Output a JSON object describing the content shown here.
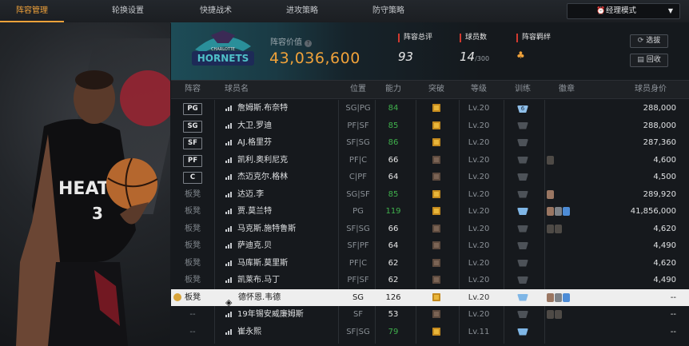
{
  "nav": {
    "tabs": [
      {
        "label": "阵容管理",
        "active": true
      },
      {
        "label": "轮换设置",
        "active": false
      },
      {
        "label": "快捷战术",
        "active": false
      },
      {
        "label": "进攻策略",
        "active": false
      },
      {
        "label": "防守策略",
        "active": false
      }
    ],
    "mode": "经理模式"
  },
  "team": {
    "value_label": "阵容价值",
    "value": "43,036,600",
    "rating_label": "阵容总评",
    "rating": "93",
    "count_label": "球员数",
    "count": "14",
    "count_max": "/300",
    "bond_label": "阵容羁绊",
    "buttons": {
      "select": "选拔",
      "recycle": "回收"
    },
    "logo_text": "CHARLOTTE HORNETS"
  },
  "columns": [
    "阵容",
    "球员名",
    "位置",
    "能力",
    "突破",
    "等级",
    "训练",
    "徽章",
    "球员身价"
  ],
  "rows": [
    {
      "slot": "PG",
      "name": "詹姆斯.布奈特",
      "pos": "SG|PG",
      "ability": "84",
      "ab_color": "g",
      "brk": "gold",
      "lv": "Lv.20",
      "train": "blue6",
      "train_num": "6",
      "badges": [],
      "price": "288,000"
    },
    {
      "slot": "SG",
      "name": "大卫.罗迪",
      "pos": "PF|SF",
      "ability": "85",
      "ab_color": "g",
      "brk": "gold",
      "lv": "Lv.20",
      "train": "gray",
      "badges": [],
      "price": "288,000"
    },
    {
      "slot": "SF",
      "name": "AJ.格里芬",
      "pos": "SF|SG",
      "ability": "86",
      "ab_color": "g",
      "brk": "gold",
      "lv": "Lv.20",
      "train": "gray",
      "badges": [],
      "price": "287,360"
    },
    {
      "slot": "PF",
      "name": "凯利.奥利尼克",
      "pos": "PF|C",
      "ability": "66",
      "ab_color": "w",
      "brk": "brown",
      "lv": "Lv.20",
      "train": "gray",
      "badges": [
        "dk"
      ],
      "price": "4,600"
    },
    {
      "slot": "C",
      "name": "杰迈克尔.格林",
      "pos": "C|PF",
      "ability": "64",
      "ab_color": "w",
      "brk": "brown",
      "lv": "Lv.20",
      "train": "gray",
      "badges": [],
      "price": "4,500"
    },
    {
      "slot": "板凳",
      "name": "达迈.李",
      "pos": "SG|SF",
      "ability": "85",
      "ab_color": "g",
      "brk": "gold",
      "lv": "Lv.20",
      "train": "gray",
      "badges": [
        "br"
      ],
      "price": "289,920"
    },
    {
      "slot": "板凳",
      "name": "贾.莫兰特",
      "pos": "PG",
      "ability": "119",
      "ab_color": "g",
      "brk": "gold",
      "lv": "Lv.20",
      "train": "blue",
      "badges": [
        "br",
        "gr",
        "bl"
      ],
      "price": "41,856,000"
    },
    {
      "slot": "板凳",
      "name": "马克斯.施特鲁斯",
      "pos": "SF|SG",
      "ability": "66",
      "ab_color": "w",
      "brk": "brown",
      "lv": "Lv.20",
      "train": "gray",
      "badges": [
        "dk",
        "dk"
      ],
      "price": "4,620"
    },
    {
      "slot": "板凳",
      "name": "萨迪克.贝",
      "pos": "SF|PF",
      "ability": "64",
      "ab_color": "w",
      "brk": "brown",
      "lv": "Lv.20",
      "train": "gray",
      "badges": [],
      "price": "4,490"
    },
    {
      "slot": "板凳",
      "name": "马库斯.莫里斯",
      "pos": "PF|C",
      "ability": "62",
      "ab_color": "w",
      "brk": "brown",
      "lv": "Lv.20",
      "train": "gray",
      "badges": [],
      "price": "4,620"
    },
    {
      "slot": "板凳",
      "name": "凯莱布.马丁",
      "pos": "PF|SF",
      "ability": "62",
      "ab_color": "w",
      "brk": "brown",
      "lv": "Lv.20",
      "train": "gray",
      "badges": [],
      "price": "4,490"
    },
    {
      "slot": "板凳",
      "name": "德怀恩.韦德",
      "pos": "SG",
      "ability": "126",
      "ab_color": "w",
      "brk": "gold",
      "lv": "Lv.20",
      "train": "blue",
      "badges": [
        "br",
        "gr",
        "bl"
      ],
      "price": "--",
      "highlight": true
    },
    {
      "slot": "--",
      "name": "19年锡安威廉姆斯",
      "pos": "SF",
      "ability": "53",
      "ab_color": "w",
      "brk": "brown",
      "lv": "Lv.20",
      "train": "gray",
      "badges": [
        "dk",
        "dk"
      ],
      "price": "--"
    },
    {
      "slot": "--",
      "name": "崔永熙",
      "pos": "SF|SG",
      "ability": "79",
      "ab_color": "g",
      "brk": "gold",
      "lv": "Lv.11",
      "train": "blue",
      "badges": [],
      "price": "--"
    }
  ]
}
